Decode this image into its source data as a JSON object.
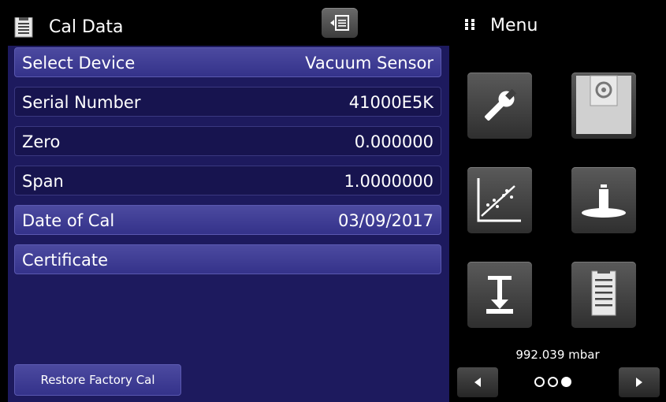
{
  "header": {
    "title": "Cal Data",
    "title_icon": "clipboard-icon",
    "back_icon": "back-icon"
  },
  "rows": [
    {
      "label": "Select Device",
      "value": "Vacuum Sensor",
      "style": "selectable"
    },
    {
      "label": "Serial Number",
      "value": "41000E5K",
      "style": "plain"
    },
    {
      "label": "Zero",
      "value": "0.000000",
      "style": "plain"
    },
    {
      "label": "Span",
      "value": "1.0000000",
      "style": "plain"
    },
    {
      "label": "Date of Cal",
      "value": "03/09/2017",
      "style": "selectable"
    },
    {
      "label": "Certificate",
      "value": "",
      "style": "selectable"
    }
  ],
  "restore_button": "Restore Factory Cal",
  "menu": {
    "title": "Menu",
    "tiles": [
      {
        "icon": "wrench-icon"
      },
      {
        "icon": "floppy-disk-icon"
      },
      {
        "icon": "calibration-chart-icon"
      },
      {
        "icon": "weight-icon"
      },
      {
        "icon": "range-icon"
      },
      {
        "icon": "clipboard-icon"
      }
    ],
    "reading": "992.039 mbar",
    "page_current": 3,
    "page_total": 3
  },
  "colors": {
    "panel": "#1d1a5e",
    "selectable_row": "#4c4aa0",
    "plain_row": "#17144f"
  }
}
